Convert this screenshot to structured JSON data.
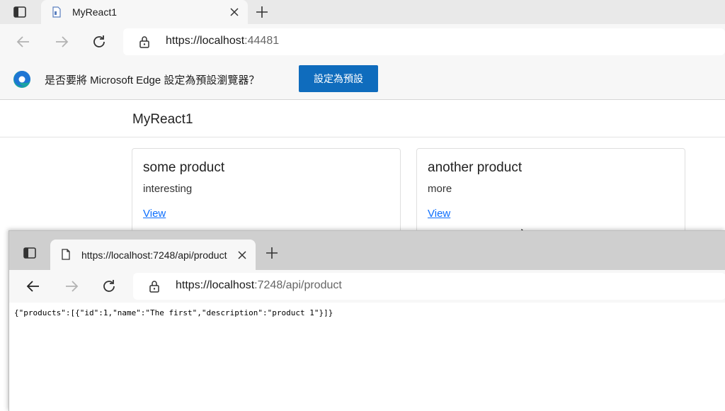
{
  "back_window": {
    "tab": {
      "title": "MyReact1"
    },
    "address_bar": {
      "host": "https://localhost",
      "port": ":44481"
    },
    "infobar": {
      "message": "是否要將 Microsoft Edge 設定為預設瀏覽器？",
      "button_label": "設定為預設"
    },
    "app": {
      "brand": "MyReact1",
      "cards": [
        {
          "title": "some product",
          "description": "interesting",
          "link": "View"
        },
        {
          "title": "another product",
          "description": "more",
          "link": "View"
        }
      ]
    }
  },
  "front_window": {
    "tab": {
      "title": "https://localhost:7248/api/product"
    },
    "address_bar": {
      "host": "https://localhost",
      "path": ":7248/api/product"
    },
    "body_text": "{\"products\":[{\"id\":1,\"name\":\"The first\",\"description\":\"product 1\"}]}"
  },
  "colors": {
    "accent": "#0f6cbd",
    "link": "#0d6efd",
    "tabstrip_back": "#e9e9e9",
    "tabstrip_front": "#cfcfcf"
  },
  "icons": [
    "tab-actions-icon",
    "page-icon",
    "close-icon",
    "plus-icon",
    "back-arrow-icon",
    "forward-arrow-icon",
    "refresh-icon",
    "lock-icon",
    "edge-logo-icon",
    "mouse-cursor-icon"
  ]
}
